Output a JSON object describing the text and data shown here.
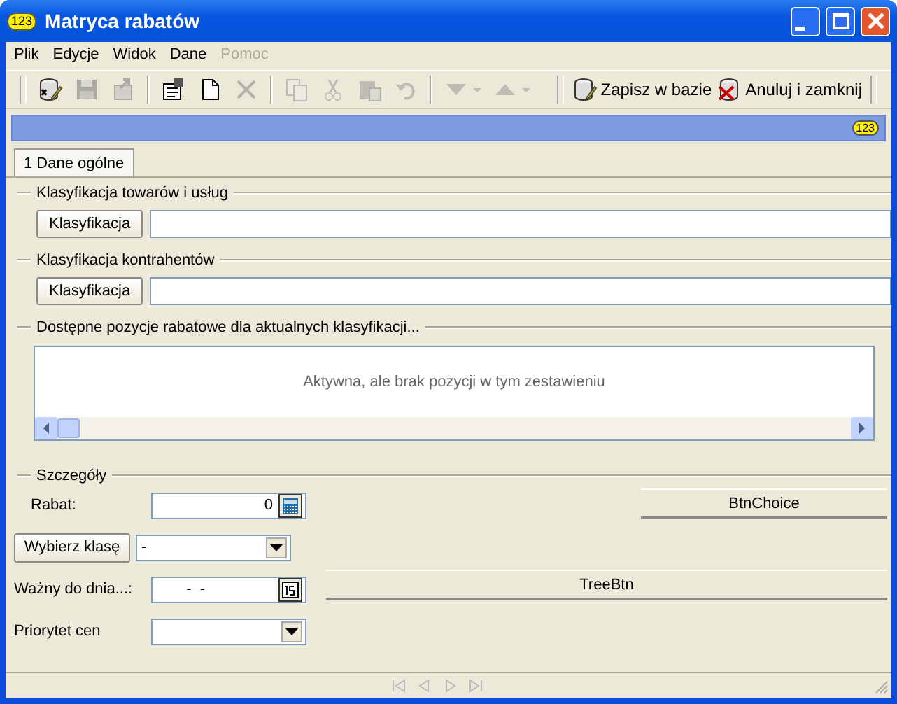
{
  "window": {
    "title": "Matryca rabatów",
    "badge": "123"
  },
  "menu": [
    {
      "label": "Plik",
      "disabled": false
    },
    {
      "label": "Edycje",
      "disabled": false
    },
    {
      "label": "Widok",
      "disabled": false
    },
    {
      "label": "Dane",
      "disabled": false
    },
    {
      "label": "Pomoc",
      "disabled": true
    }
  ],
  "toolbar": [
    {
      "kind": "database",
      "disabled": false
    },
    {
      "kind": "floppy",
      "disabled": true
    },
    {
      "kind": "export",
      "disabled": true
    },
    {
      "kind": "separator"
    },
    {
      "kind": "properties",
      "disabled": false
    },
    {
      "kind": "page",
      "disabled": false
    },
    {
      "kind": "delete",
      "disabled": true
    },
    {
      "kind": "separator"
    },
    {
      "kind": "copy",
      "disabled": true
    },
    {
      "kind": "cut",
      "disabled": true
    },
    {
      "kind": "paste",
      "disabled": true
    },
    {
      "kind": "undo",
      "disabled": true
    },
    {
      "kind": "separator"
    },
    {
      "kind": "down",
      "disabled": true
    },
    {
      "kind": "up",
      "disabled": true
    }
  ],
  "actions": [
    {
      "kind": "save",
      "label": "Zapisz w bazie"
    },
    {
      "kind": "cancel",
      "label": "Anuluj i zamknij"
    }
  ],
  "band": {
    "badge": "123"
  },
  "tabs": [
    {
      "label": "1 Dane ogólne",
      "selected": true
    }
  ],
  "groups": [
    {
      "title": "Klasyfikacja towarów i usług",
      "button": "Klasyfikacja"
    },
    {
      "title": "Klasyfikacja kontrahentów",
      "button": "Klasyfikacja"
    }
  ],
  "positions": {
    "title": "Dostępne pozycje rabatowe dla aktualnych klasyfikacji...",
    "empty_message": "Aktywna, ale brak pozycji w tym zestawieniu"
  },
  "details": {
    "title": "Szczegóły",
    "rabat": {
      "label": "Rabat:",
      "value": "0"
    },
    "class": {
      "button": "Wybierz klasę",
      "value": "-"
    },
    "valid": {
      "label": "Ważny do dnia...:",
      "value": "  -  -"
    },
    "priority": {
      "label": "Priorytet cen"
    },
    "choice_button": "BtnChoice",
    "tree_button": "TreeBtn"
  }
}
